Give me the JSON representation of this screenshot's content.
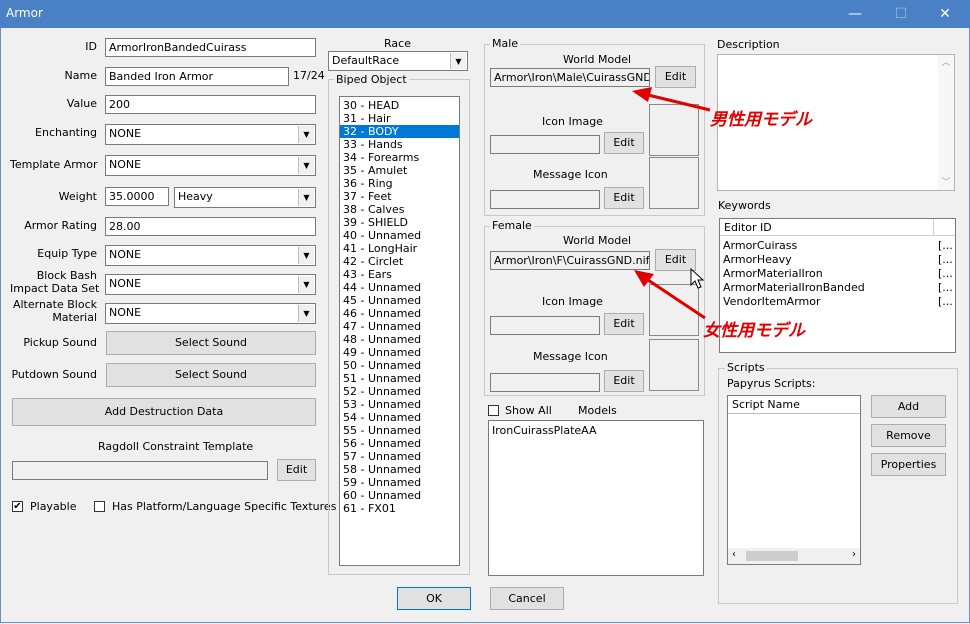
{
  "window": {
    "title": "Armor",
    "minimize": "—",
    "maximize": "☐",
    "close": "✕"
  },
  "left": {
    "id_label": "ID",
    "id_value": "ArmorIronBandedCuirass",
    "name_label": "Name",
    "name_value": "Banded Iron Armor",
    "name_count": "17/24",
    "value_label": "Value",
    "value_value": "200",
    "enchanting_label": "Enchanting",
    "enchanting_value": "NONE",
    "template_label": "Template Armor",
    "template_value": "NONE",
    "weight_label": "Weight",
    "weight_value": "35.0000",
    "weight_class": "Heavy",
    "rating_label": "Armor Rating",
    "rating_value": "28.00",
    "equip_label": "Equip Type",
    "equip_value": "NONE",
    "blockbash_label1": "Block Bash",
    "blockbash_label2": "Impact Data Set",
    "blockbash_value": "NONE",
    "altblock_label1": "Alternate Block",
    "altblock_label2": "Material",
    "altblock_value": "NONE",
    "pickup_label": "Pickup Sound",
    "pickup_button": "Select Sound",
    "putdown_label": "Putdown Sound",
    "putdown_button": "Select Sound",
    "destruction_button": "Add Destruction Data",
    "ragdoll_label": "Ragdoll Constraint Template",
    "ragdoll_value": "",
    "ragdoll_edit": "Edit",
    "playable_label": "Playable",
    "playable_checked": "✔",
    "platform_label": "Has Platform/Language Specific Textures"
  },
  "race": {
    "label": "Race",
    "value": "DefaultRace"
  },
  "biped": {
    "label": "Biped Object",
    "items": [
      "30 - HEAD",
      "31 - Hair",
      "32 - BODY",
      "33 - Hands",
      "34 - Forearms",
      "35 - Amulet",
      "36 - Ring",
      "37 - Feet",
      "38 - Calves",
      "39 - SHIELD",
      "40 - Unnamed",
      "41 - LongHair",
      "42 - Circlet",
      "43 - Ears",
      "44 - Unnamed",
      "45 - Unnamed",
      "46 - Unnamed",
      "47 - Unnamed",
      "48 - Unnamed",
      "49 - Unnamed",
      "50 - Unnamed",
      "51 - Unnamed",
      "52 - Unnamed",
      "53 - Unnamed",
      "54 - Unnamed",
      "55 - Unnamed",
      "56 - Unnamed",
      "57 - Unnamed",
      "58 - Unnamed",
      "59 - Unnamed",
      "60 - Unnamed",
      "61 - FX01"
    ],
    "selected": "32 - BODY"
  },
  "male": {
    "label": "Male",
    "world_model_label": "World Model",
    "world_model_value": "Armor\\Iron\\Male\\CuirassGND.nif",
    "edit": "Edit",
    "icon_label": "Icon Image",
    "icon_edit": "Edit",
    "msg_label": "Message Icon",
    "msg_edit": "Edit"
  },
  "female": {
    "label": "Female",
    "world_model_label": "World Model",
    "world_model_value": "Armor\\Iron\\F\\CuirassGND.nif",
    "edit": "Edit",
    "icon_label": "Icon Image",
    "icon_edit": "Edit",
    "msg_label": "Message Icon",
    "msg_edit": "Edit"
  },
  "models": {
    "show_all": "Show All",
    "label": "Models",
    "items": [
      "IronCuirassPlateAA"
    ]
  },
  "description": {
    "label": "Description"
  },
  "keywords": {
    "label": "Keywords",
    "col_editor_id": "Editor ID",
    "items": [
      "ArmorCuirass",
      "ArmorHeavy",
      "ArmorMaterialIron",
      "ArmorMaterialIronBanded",
      "VendorItemArmor"
    ],
    "suffix": "[..."
  },
  "scripts": {
    "label": "Scripts",
    "papyrus_label": "Papyrus Scripts:",
    "col_name": "Script Name",
    "add": "Add",
    "remove": "Remove",
    "properties": "Properties"
  },
  "dialog": {
    "ok": "OK",
    "cancel": "Cancel"
  },
  "annotations": {
    "male_note": "男性用モデル",
    "female_note": "女性用モデル",
    "color": "#e00000"
  }
}
